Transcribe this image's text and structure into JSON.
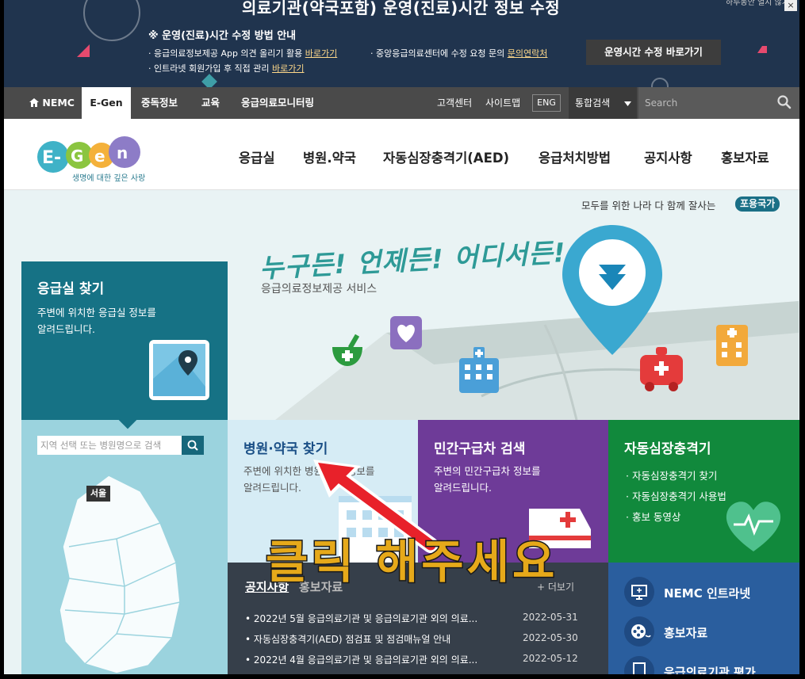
{
  "banner": {
    "title": "의료기관(약국포함) 운영(진료)시간 정보 수정",
    "subtitle": "※ 운영(진료)시간 수정 방법 안내",
    "line1_text": "· 응급의료정보제공 App 의견 올리기 활용 ",
    "line1_link": "바로가기",
    "line2_text": "· 중앙응급의료센터에 수정 요청 문의 ",
    "line2_link": "문의연락처",
    "line3_text": "· 인트라넷 회원가입 후 직접 관리 ",
    "line3_link": "바로가기",
    "button_label": "운영시간 수정 바로가기",
    "close_label": "하루동안 열지 않기",
    "close_x": "×"
  },
  "nav": {
    "home_label": "NEMC",
    "items": [
      "E-Gen",
      "중독정보",
      "교육",
      "응급의료모니터링"
    ],
    "utils": [
      "고객센터",
      "사이트맵"
    ],
    "eng_label": "ENG",
    "search_scope": "통합검색",
    "search_placeholder": "Search"
  },
  "header": {
    "logo_tagline": "생명에 대한 깊은 사랑",
    "logo_text": "E-Gen",
    "menu": [
      "응급실",
      "병원.약국",
      "자동심장충격기(AED)",
      "응급처치방법",
      "공지사항",
      "홍보자료"
    ]
  },
  "tagline": {
    "text": "모두를 위한 나라 다 함께 잘사는",
    "badge": "포용국가"
  },
  "hero": {
    "slogan": "누구든! 언제든! 어디서든!",
    "subtitle": "응급의료정보제공 서비스"
  },
  "tiles": {
    "er": {
      "title": "응급실 찾기",
      "desc1": "주변에 위치한 응급실 정보를",
      "desc2": "알려드립니다."
    },
    "map": {
      "search_placeholder": "지역 선택 또는 병원명으로 검색",
      "seoul_label": "서울"
    },
    "hospital": {
      "title": "병원·약국 찾기",
      "desc1": "주변에 위치한 병원·약국 정보를",
      "desc2": "알려드립니다."
    },
    "ambulance": {
      "title": "민간구급차 검색",
      "desc1": "주변의 민간구급차 정보를",
      "desc2": "알려드립니다."
    },
    "aed": {
      "title": "자동심장충격기",
      "items": [
        "자동심장충격기 찾기",
        "자동심장충격기 사용법",
        "홍보 동영상"
      ]
    }
  },
  "notice": {
    "tabs": [
      "공지사항",
      "홍보자료"
    ],
    "more_label": "+ 더보기",
    "rows": [
      {
        "title": "2022년 5월 응급의료기관 및 응급의료기관 외의 의료...",
        "date": "2022-05-31"
      },
      {
        "title": "자동심장충격기(AED) 점검표 및 점검매뉴얼 안내",
        "date": "2022-05-30"
      },
      {
        "title": "2022년 4월 응급의료기관 및 응급의료기관 외의 의료...",
        "date": "2022-05-12"
      }
    ]
  },
  "quick": {
    "items": [
      "NEMC 인트라넷",
      "홍보자료",
      "응급의료기관 평가"
    ]
  },
  "annotation": {
    "text": "클릭 해주세요"
  },
  "colors": {
    "banner_bg": "#20344e",
    "er_tile": "#167285",
    "ambulance_tile": "#6e3b98",
    "aed_tile": "#11893c",
    "quick_bg": "#2a5e9e",
    "annotation": "#e6a91a",
    "arrow": "#e8212a"
  }
}
